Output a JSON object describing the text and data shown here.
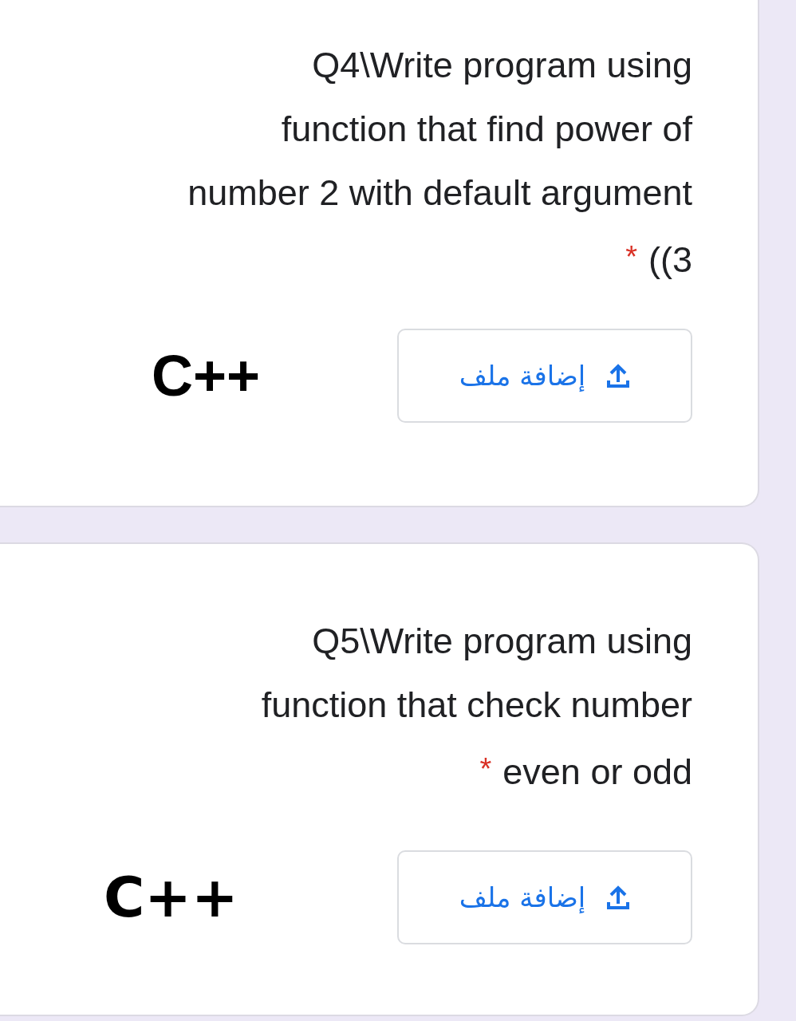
{
  "questions": [
    {
      "lines": [
        "Q4\\Write program using",
        "function that find power of",
        "number 2 with default argument",
        "((3"
      ],
      "required": true,
      "required_mark": "*",
      "note": "C++",
      "upload_button": {
        "label": "إضافة ملف"
      }
    },
    {
      "lines": [
        "Q5\\Write program using",
        "function that check number",
        "even or odd"
      ],
      "required": true,
      "required_mark": "*",
      "note": "C++",
      "upload_button": {
        "label": "إضافة ملف"
      }
    }
  ]
}
